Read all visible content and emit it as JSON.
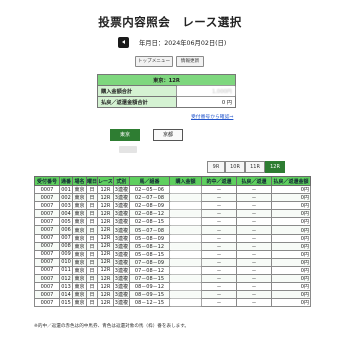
{
  "page": {
    "title": "投票内容照会　レース選択",
    "date_label": "年月日：2024年06月02日(日)"
  },
  "buttons": {
    "top_menu": "トップメニュー",
    "info_update": "情報更新"
  },
  "summary": {
    "header": "東京：12R",
    "rows": [
      {
        "label": "購入金額合計",
        "value": "1,000円"
      },
      {
        "label": "払戻／返還金額合計",
        "value": "0 円"
      }
    ]
  },
  "receipt_link": "受付番号から確認⇒",
  "venues": [
    {
      "label": "東京",
      "active": true
    },
    {
      "label": "京都",
      "active": false
    }
  ],
  "race_tabs": [
    {
      "label": "9R",
      "active": false
    },
    {
      "label": "10R",
      "active": false
    },
    {
      "label": "11R",
      "active": false
    },
    {
      "label": "12R",
      "active": true
    }
  ],
  "table": {
    "headers": [
      "受付番号",
      "通番",
      "場名",
      "曜日",
      "レース",
      "式別",
      "馬／組番",
      "購入金額",
      "的中／返還",
      "払戻／返還",
      "払戻／返還金額"
    ],
    "rows": [
      [
        "0007",
        "001",
        "東京",
        "日",
        "12R",
        "3連複",
        "02－05－06",
        "",
        "－",
        "－",
        "0円"
      ],
      [
        "0007",
        "002",
        "東京",
        "日",
        "12R",
        "3連複",
        "02－07－08",
        "",
        "－",
        "－",
        "0円"
      ],
      [
        "0007",
        "003",
        "東京",
        "日",
        "12R",
        "3連複",
        "02－08－09",
        "",
        "－",
        "－",
        "0円"
      ],
      [
        "0007",
        "004",
        "東京",
        "日",
        "12R",
        "3連複",
        "02－08－12",
        "",
        "－",
        "－",
        "0円"
      ],
      [
        "0007",
        "005",
        "東京",
        "日",
        "12R",
        "3連複",
        "02－08－15",
        "",
        "－",
        "－",
        "0円"
      ],
      [
        "0007",
        "006",
        "東京",
        "日",
        "12R",
        "3連複",
        "05－07－08",
        "",
        "－",
        "－",
        "0円"
      ],
      [
        "0007",
        "007",
        "東京",
        "日",
        "12R",
        "3連複",
        "05－08－09",
        "",
        "－",
        "－",
        "0円"
      ],
      [
        "0007",
        "008",
        "東京",
        "日",
        "12R",
        "3連複",
        "05－08－12",
        "",
        "－",
        "－",
        "0円"
      ],
      [
        "0007",
        "009",
        "東京",
        "日",
        "12R",
        "3連複",
        "05－08－15",
        "",
        "－",
        "－",
        "0円"
      ],
      [
        "0007",
        "010",
        "東京",
        "日",
        "12R",
        "3連複",
        "07－08－09",
        "",
        "－",
        "－",
        "0円"
      ],
      [
        "0007",
        "011",
        "東京",
        "日",
        "12R",
        "3連複",
        "07－08－12",
        "",
        "－",
        "－",
        "0円"
      ],
      [
        "0007",
        "012",
        "東京",
        "日",
        "12R",
        "3連複",
        "07－08－15",
        "",
        "－",
        "－",
        "0円"
      ],
      [
        "0007",
        "013",
        "東京",
        "日",
        "12R",
        "3連複",
        "08－09－12",
        "",
        "－",
        "－",
        "0円"
      ],
      [
        "0007",
        "014",
        "東京",
        "日",
        "12R",
        "3連複",
        "08－09－15",
        "",
        "－",
        "－",
        "0円"
      ],
      [
        "0007",
        "015",
        "東京",
        "日",
        "12R",
        "3連複",
        "08－12－15",
        "",
        "－",
        "－",
        "0円"
      ]
    ]
  },
  "footnote": "※的中／返還の赤色は的中馬券、青色は返還対象の馬（枠）番を表します。",
  "colors": {
    "accent": "#2e7d32",
    "header_green": "#5fcf5f",
    "summary_header": "#7ed77e"
  }
}
